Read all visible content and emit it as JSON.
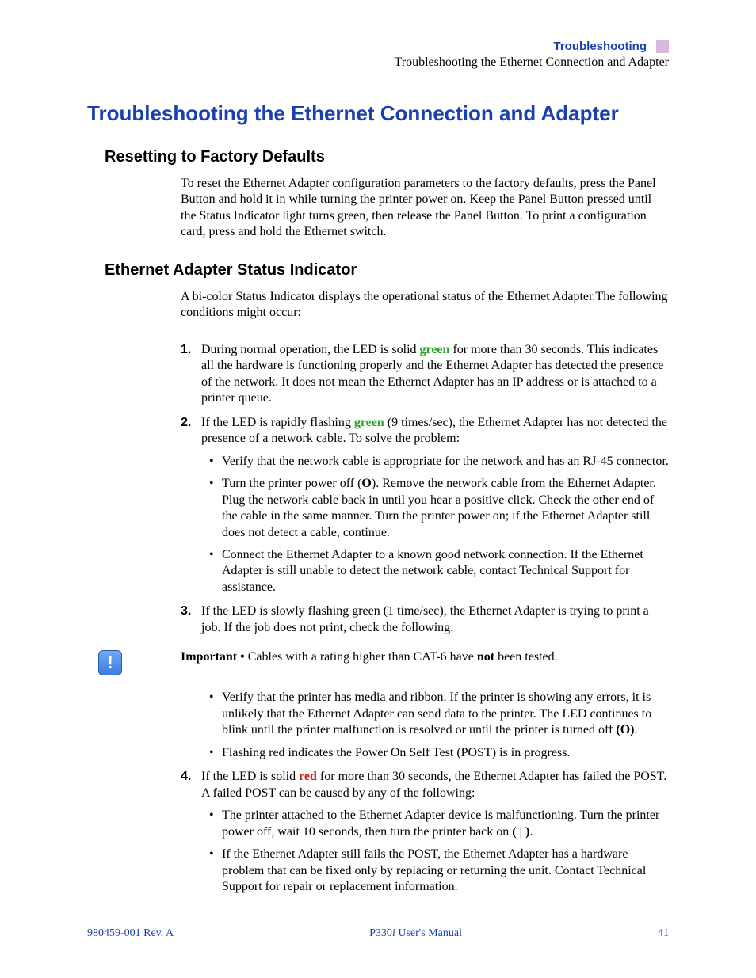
{
  "header": {
    "category": "Troubleshooting",
    "subtitle": "Troubleshooting the Ethernet Connection and Adapter"
  },
  "title": "Troubleshooting the Ethernet Connection and Adapter",
  "section1": {
    "heading": "Resetting to Factory Defaults",
    "body": "To reset the Ethernet Adapter configuration parameters to the factory defaults, press the Panel Button and hold it in while turning the printer power on. Keep the Panel Button pressed until the Status Indicator light turns green, then release the Panel Button. To print a configuration card, press and hold the Ethernet switch."
  },
  "section2": {
    "heading": "Ethernet Adapter Status Indicator",
    "intro": "A bi-color Status Indicator displays the operational status of the Ethernet Adapter.The following conditions might occur:",
    "items": [
      {
        "num": "1.",
        "pre": "During normal operation, the LED is solid ",
        "color_word": "green",
        "post": " for more than 30 seconds. This indicates all the hardware is functioning properly and the Ethernet Adapter has detected the presence of the network. It does not mean the Ethernet Adapter has an IP address or is attached to a printer queue."
      },
      {
        "num": "2.",
        "pre": "If the LED is rapidly flashing ",
        "color_word": "green",
        "post": " (9 times/sec), the Ethernet Adapter has not detected the presence of a network cable. To solve the problem:",
        "bullets": [
          "Verify that the network cable is appropriate for the network and has an RJ-45 connector.",
          "Turn the printer power off (O). Remove the network cable from the Ethernet Adapter. Plug the network cable back in until you hear a positive click. Check the other end of the cable in the same manner. Turn the printer power on; if the Ethernet Adapter still does not detect a cable, continue.",
          "Connect the Ethernet Adapter to a known good network connection. If the Ethernet Adapter is still unable to detect the network cable, contact Technical Support for assistance."
        ]
      },
      {
        "num": "3.",
        "text": "If the LED is slowly flashing green (1 time/sec), the Ethernet Adapter is trying to print a job. If the job does not print, check the following:"
      }
    ],
    "important": {
      "label": "Important •",
      "pre": " Cables with a rating higher than CAT-6 have ",
      "bold": "not",
      "post": " been tested."
    },
    "after_important_bullets": [
      "Verify that the printer has media and ribbon. If the printer is showing any errors, it is unlikely that the Ethernet Adapter can send data to the printer. The LED continues to blink until the printer malfunction is resolved or until the printer is turned off (O).",
      "Flashing red indicates the Power On Self Test (POST) is in progress."
    ],
    "item4": {
      "num": "4.",
      "pre": "If the LED is solid ",
      "color_word": "red",
      "post": " for more than 30 seconds, the Ethernet Adapter has failed the POST. A failed POST can be caused by any of the following:",
      "bullets": [
        "The printer attached to the Ethernet Adapter device is malfunctioning. Turn the printer power off, wait 10 seconds, then turn the printer back on ( | ).",
        "If the Ethernet Adapter still fails the POST, the Ethernet Adapter has a hardware problem that can be fixed only by replacing or returning the unit. Contact Technical Support for repair or replacement information."
      ]
    }
  },
  "footer": {
    "left": "980459-001 Rev. A",
    "center_prefix": "P330",
    "center_ital": "i",
    "center_suffix": " User's Manual",
    "right": "41"
  },
  "symbols": {
    "O_bold": "O",
    "pipe_bold": "( | )"
  }
}
